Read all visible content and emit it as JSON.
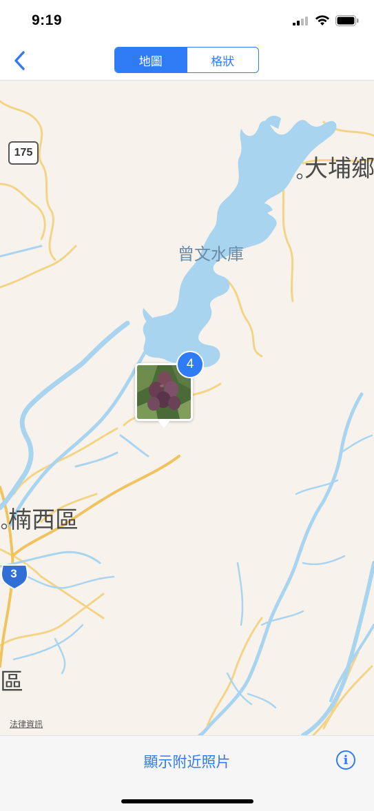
{
  "status": {
    "time": "9:19"
  },
  "nav": {
    "back_icon": "chevron-left-icon",
    "segments": [
      {
        "label": "地圖",
        "active": true
      },
      {
        "label": "格狀",
        "active": false
      }
    ]
  },
  "map": {
    "labels": {
      "reservoir": "曾文水庫",
      "dapu": "大埔鄉",
      "nanxi": "楠西區",
      "partial_district": "區"
    },
    "route_shields": {
      "provincial": "3",
      "county": "175"
    },
    "photo_cluster_count": "4",
    "legal_link": "法律資訊",
    "colors": {
      "water": "#a8d4f0",
      "road": "#f3d487",
      "land": "#f7f3ec",
      "accent": "#2f7bf6"
    }
  },
  "toolbar": {
    "nearby_label": "顯示附近照片",
    "info_icon": "info-icon"
  }
}
